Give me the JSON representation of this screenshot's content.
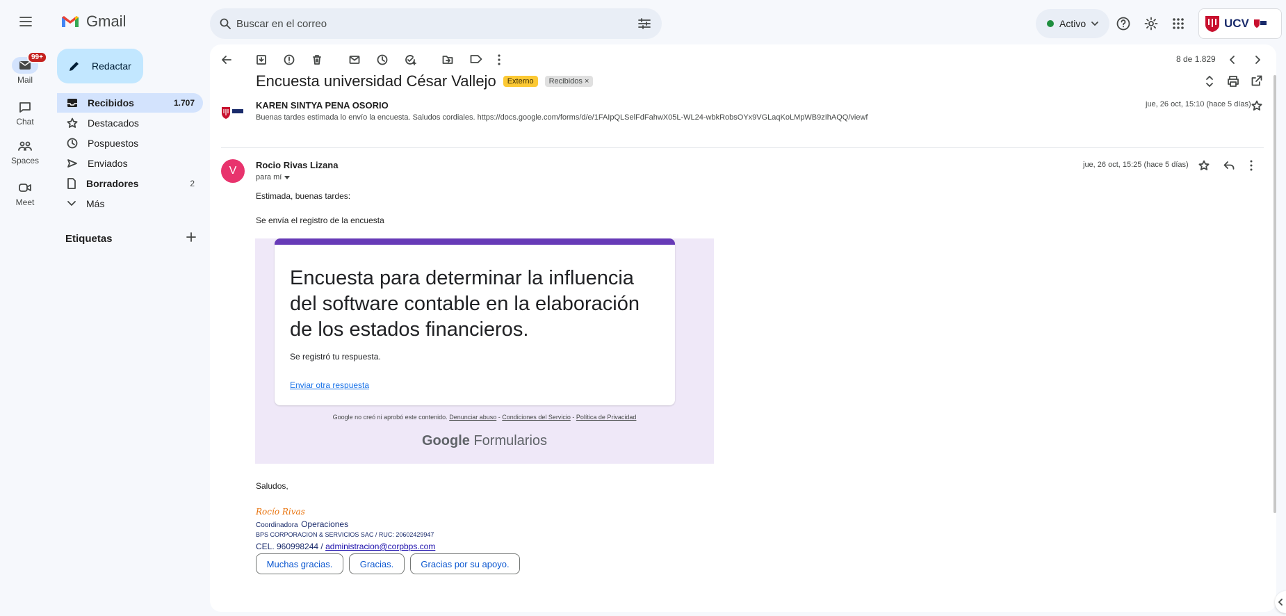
{
  "app": {
    "name": "Gmail"
  },
  "rail": [
    {
      "label": "Mail",
      "badge": "99+"
    },
    {
      "label": "Chat"
    },
    {
      "label": "Spaces"
    },
    {
      "label": "Meet"
    }
  ],
  "search": {
    "placeholder": "Buscar en el correo"
  },
  "status": {
    "label": "Activo"
  },
  "compose": {
    "label": "Redactar"
  },
  "nav": [
    {
      "label": "Recibidos",
      "count": "1.707"
    },
    {
      "label": "Destacados"
    },
    {
      "label": "Pospuestos"
    },
    {
      "label": "Enviados"
    },
    {
      "label": "Borradores",
      "count": "2"
    },
    {
      "label": "Más"
    }
  ],
  "labels_title": "Etiquetas",
  "pagination": "8 de 1.829",
  "thread": {
    "subject": "Encuesta universidad César Vallejo",
    "chip_external": "Externo",
    "chip_inbox": "Recibidos ×"
  },
  "message1": {
    "sender": "KAREN SINTYA PENA OSORIO",
    "snippet": "Buenas tardes estimada lo envío la encuesta. Saludos cordiales. https://docs.google.com/forms/d/e/1FAIpQLSelFdFahwX05L-WL24-wbkRobsOYx9VGLaqKoLMpWB9zIhAQQ/viewf",
    "date": "jue, 26 oct, 15:10 (hace 5 días)"
  },
  "message2": {
    "avatar_letter": "V",
    "sender": "Rocio Rivas Lizana",
    "to": "para mí",
    "date": "jue, 26 oct, 15:25 (hace 5 días)",
    "greeting": "Estimada, buenas tardes:",
    "line1": "Se envía el registro de la encuesta",
    "form": {
      "title": "Encuesta para determinar la influencia del software contable en la elaboración de los estados financieros.",
      "registered": "Se registró tu respuesta.",
      "another": "Enviar otra respuesta",
      "disclaimer_prefix": "Google no creó ni aprobó este contenido.",
      "report_abuse": "Denunciar abuso",
      "terms": "Condiciones del Servicio",
      "privacy": "Política de Privacidad",
      "sep": "-",
      "brand_google": "Google",
      "brand_forms": "Formularios"
    },
    "closing": "Saludos,",
    "sig_name": "Rocío Rivas",
    "sig_role_small": "Coordinadora",
    "sig_role": "Operaciones",
    "sig_company": "BPS CORPORACION & SERVICIOS SAC / RUC: 20602429947",
    "sig_phone": "CEL. 960998244 /",
    "sig_email": "administracion@corpbps.com",
    "ellipsis": "•••"
  },
  "smart_replies": [
    "Muchas gracias.",
    "Gracias.",
    "Gracias por su apoyo."
  ],
  "account": {
    "brand": "UCV"
  },
  "colors": {
    "accent": "#0b57d0",
    "compose": "#c2e7ff",
    "active_nav": "#d3e3fd",
    "avatar": "#e8336d",
    "form_purple": "#673ab7",
    "ucv_red": "#c8102e"
  }
}
